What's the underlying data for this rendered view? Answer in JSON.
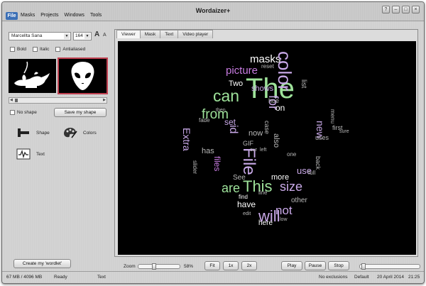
{
  "window": {
    "title": "Wordaizer+",
    "file_label": "File",
    "menu": [
      "Masks",
      "Projects",
      "Windows",
      "Tools"
    ]
  },
  "font": {
    "family": "Marcellta Sana",
    "size": "164",
    "grow_label": "A",
    "shrink_label": "A"
  },
  "style_options": {
    "bold": "Bold",
    "italic": "Italic",
    "antialiased": "Antialiased"
  },
  "shape": {
    "no_shape_label": "No shape",
    "save_button": "Save my shape"
  },
  "tools": {
    "shape": "Shape",
    "colors": "Colors",
    "text": "Text"
  },
  "create_button": "Create my 'wordlet'",
  "tabs": [
    "Viewer",
    "Mask",
    "Text",
    "Video player"
  ],
  "zoom": {
    "label": "Zoom",
    "percent": "58%",
    "fit": "Fit",
    "x1": "1x",
    "x2": "2x"
  },
  "playback": {
    "play": "Play",
    "pause": "Pause",
    "stop": "Stop"
  },
  "status": {
    "memory": "67 MB / 4096 MB",
    "state": "Ready",
    "mode": "Text",
    "exclusions": "No exclusions",
    "profile": "Default",
    "date": "20 April 2014",
    "time": "21:25"
  },
  "colors": {
    "green": "#9ee29a",
    "purple": "#c77be0",
    "lavender": "#c9a9e8",
    "white": "#ffffff",
    "gray": "#b8b8b8"
  },
  "words": [
    {
      "t": "masks",
      "c": "white"
    },
    {
      "t": "picture",
      "c": "purple"
    },
    {
      "t": "The",
      "c": "green"
    },
    {
      "t": "can",
      "c": "green"
    },
    {
      "t": "color",
      "c": "lavender"
    },
    {
      "t": "Two",
      "c": "white"
    },
    {
      "t": "shows",
      "c": "lavender"
    },
    {
      "t": "from",
      "c": "green"
    },
    {
      "t": "for",
      "c": "lavender"
    },
    {
      "t": "on",
      "c": "white"
    },
    {
      "t": "set",
      "c": "lavender"
    },
    {
      "t": "id",
      "c": "lavender"
    },
    {
      "t": "now",
      "c": "gray"
    },
    {
      "t": "new",
      "c": "lavender"
    },
    {
      "t": "first",
      "c": "gray"
    },
    {
      "t": "also",
      "c": "gray"
    },
    {
      "t": "Extra",
      "c": "lavender"
    },
    {
      "t": "has",
      "c": "gray"
    },
    {
      "t": "files",
      "c": "purple"
    },
    {
      "t": "File",
      "c": "lavender"
    },
    {
      "t": "use",
      "c": "lavender"
    },
    {
      "t": "See",
      "c": "gray"
    },
    {
      "t": "more",
      "c": "white"
    },
    {
      "t": "are",
      "c": "green"
    },
    {
      "t": "This",
      "c": "green"
    },
    {
      "t": "size",
      "c": "lavender"
    },
    {
      "t": "have",
      "c": "white"
    },
    {
      "t": "other",
      "c": "gray"
    },
    {
      "t": "not",
      "c": "lavender"
    },
    {
      "t": "will",
      "c": "lavender"
    },
    {
      "t": "here",
      "c": "white"
    },
    {
      "t": "edit",
      "c": "gray"
    },
    {
      "t": "low",
      "c": "gray"
    },
    {
      "t": "find",
      "c": "white"
    },
    {
      "t": "hue",
      "c": "gray"
    },
    {
      "t": "reset",
      "c": "gray"
    },
    {
      "t": "GIF",
      "c": "gray"
    },
    {
      "t": "full",
      "c": "gray"
    },
    {
      "t": "line",
      "c": "gray"
    },
    {
      "t": "slider",
      "c": "gray"
    },
    {
      "t": "our",
      "c": "gray"
    },
    {
      "t": "left",
      "c": "gray"
    },
    {
      "t": "list",
      "c": "gray"
    },
    {
      "t": "menu",
      "c": "gray"
    },
    {
      "t": "sure",
      "c": "gray"
    },
    {
      "t": "back",
      "c": "gray"
    },
    {
      "t": "uses",
      "c": "gray"
    },
    {
      "t": "one",
      "c": "gray"
    },
    {
      "t": "fade",
      "c": "gray"
    },
    {
      "t": "then",
      "c": "gray"
    },
    {
      "t": "case",
      "c": "gray"
    }
  ]
}
